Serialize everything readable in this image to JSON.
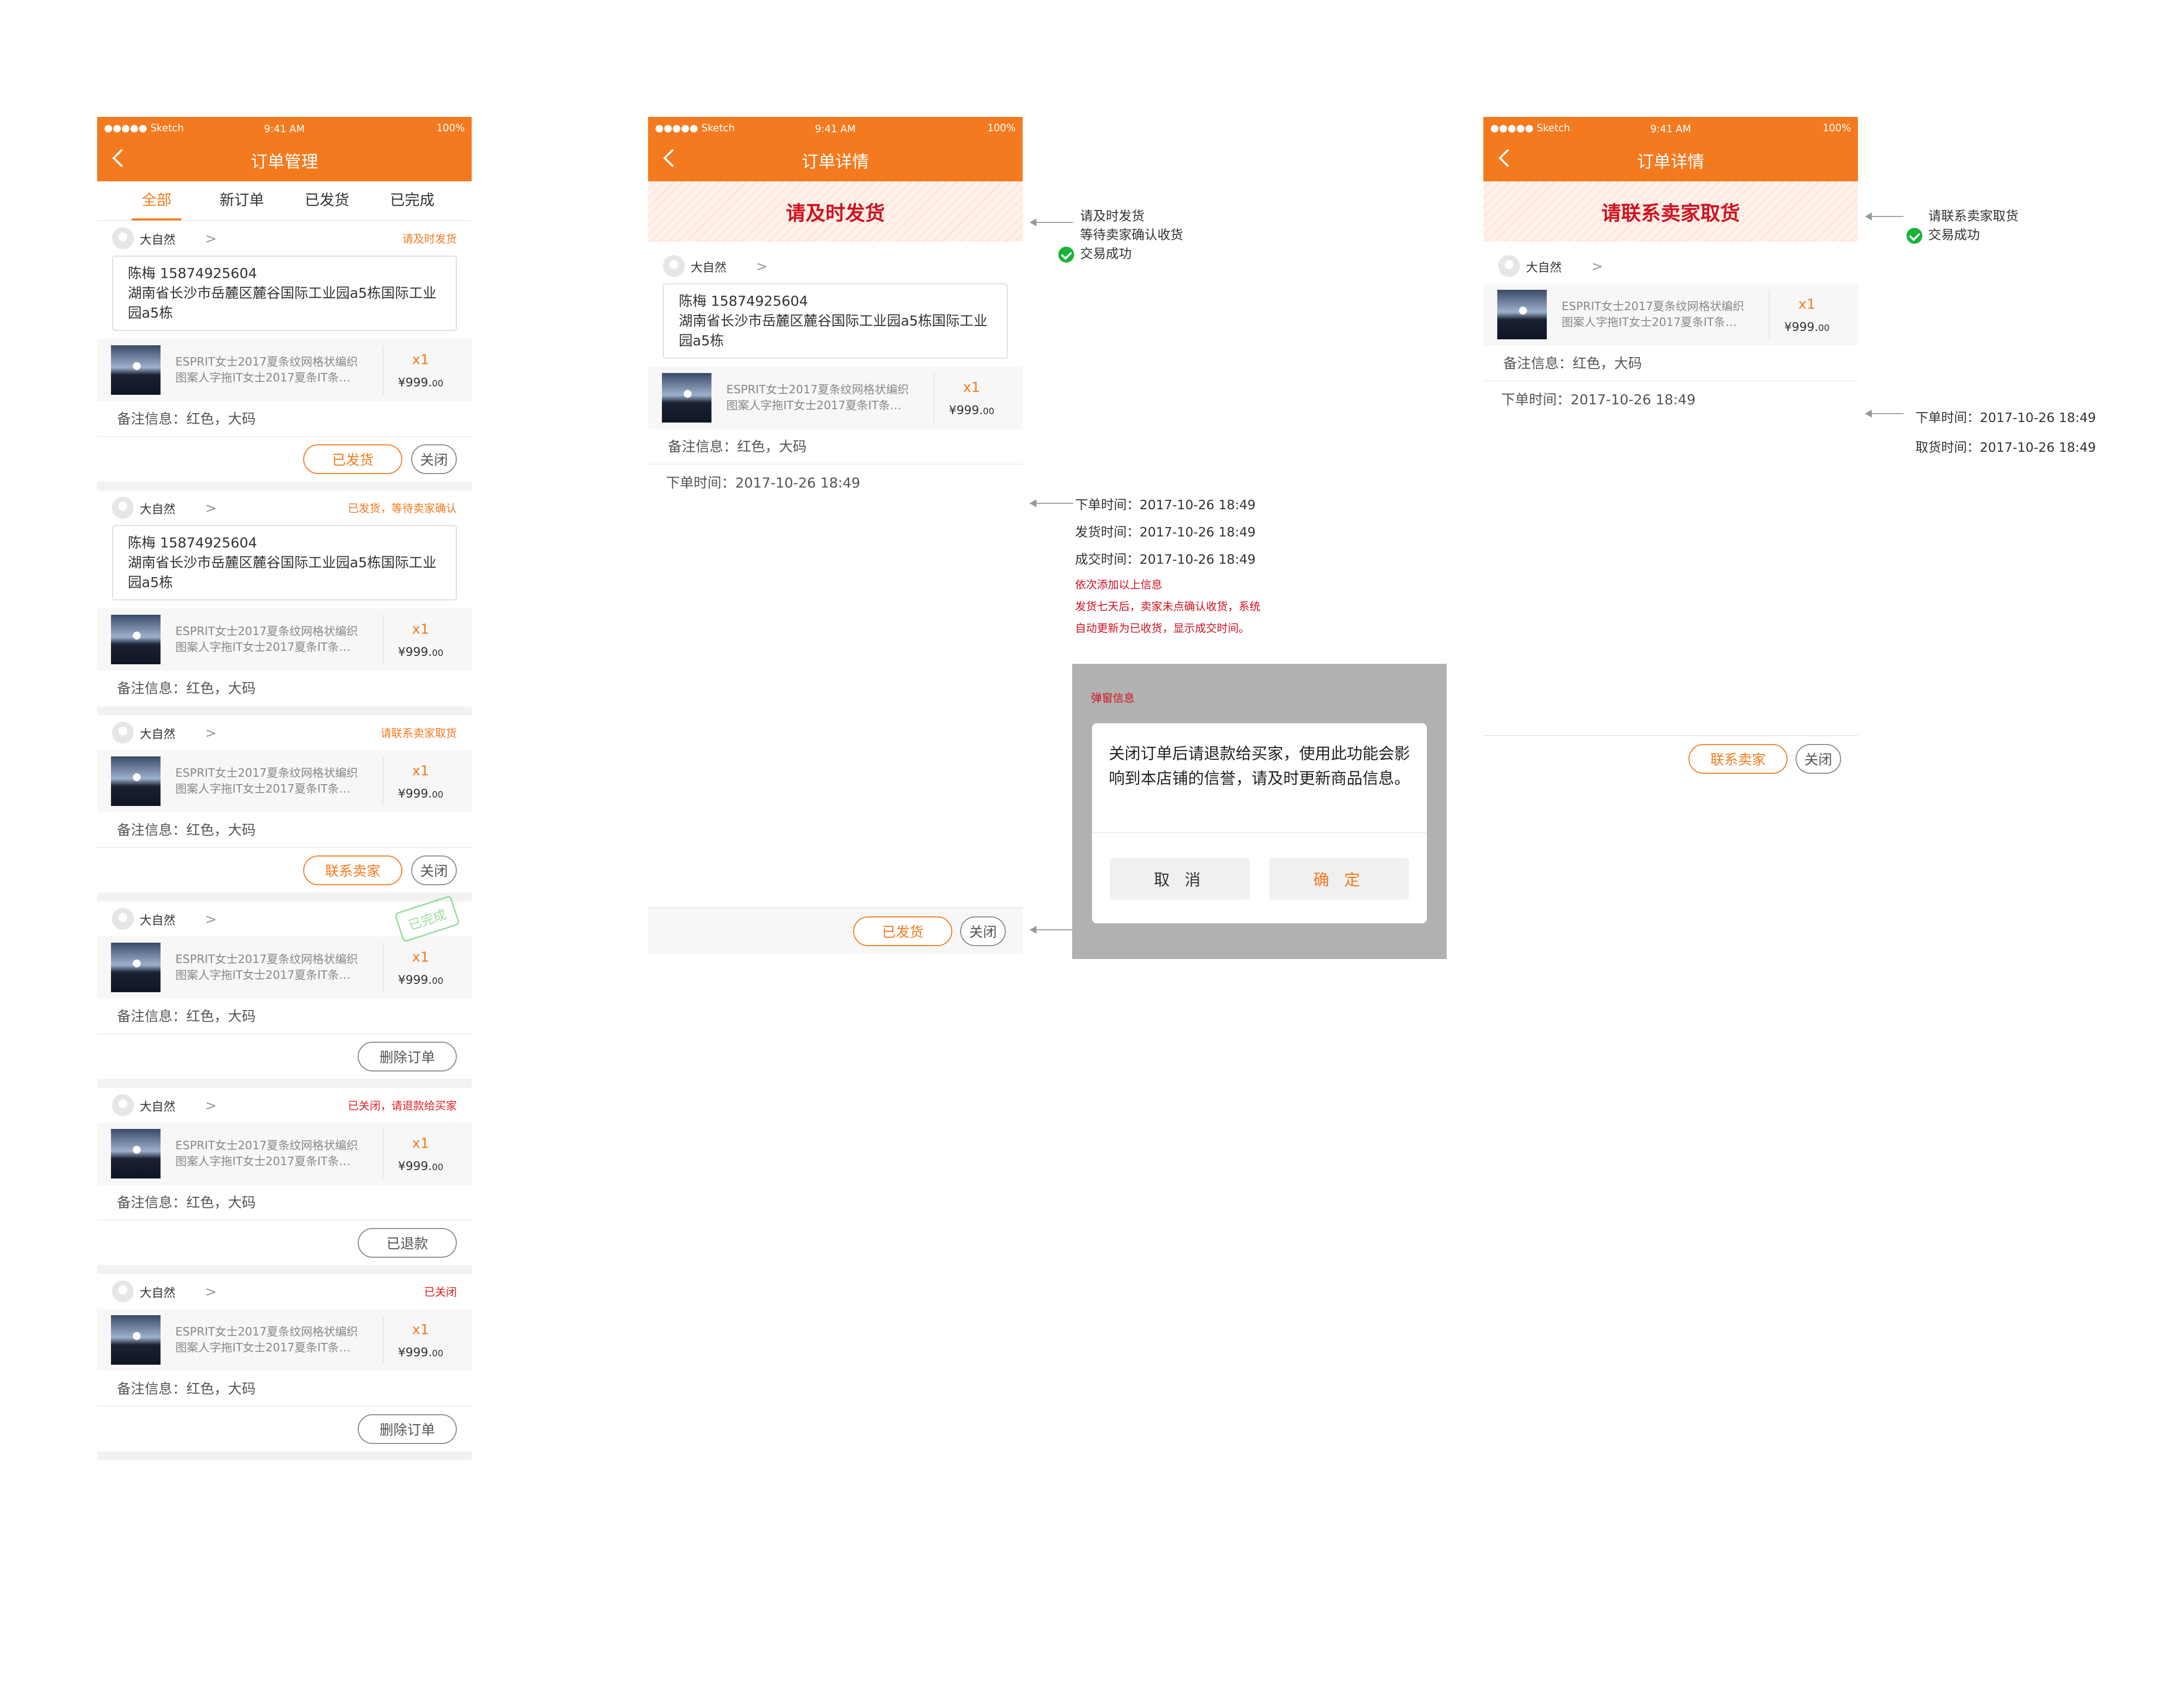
{
  "status_bar": {
    "carrier": "●●●●● Sketch",
    "time": "9:41 AM",
    "battery": "100%"
  },
  "common": {
    "shop": "大自然",
    "contact": "陈梅    15874925604",
    "address": "湖南省长沙市岳麓区麓谷国际工业园a5栋国际工业园a5栋",
    "product_line1": "ESPRIT女士2017夏条纹网格状编织",
    "product_line2": "图案人字拖IT女士2017夏条IT条…",
    "qty": "x1",
    "price": "¥999.",
    "price_cents": "00",
    "remark": "备注信息：红色，大码",
    "order_time": "下单时间：2017-10-26  18:49",
    "chevron": ">"
  },
  "screen1": {
    "title": "订单管理",
    "tabs": [
      "全部",
      "新订单",
      "已发货",
      "已完成"
    ],
    "orders": [
      {
        "status": "请及时发货",
        "btn1": "已发货",
        "btn2": "关闭"
      },
      {
        "status": "已发货，等待卖家确认"
      },
      {
        "status": "请联系卖家取货",
        "btn1": "联系卖家",
        "btn2": "关闭"
      },
      {
        "stamp": "已完成",
        "btn1": "删除订单"
      },
      {
        "status": "已关闭，请退款给买家",
        "btn1": "已退款"
      },
      {
        "status": "已关闭",
        "btn1": "删除订单"
      }
    ]
  },
  "screen2": {
    "title": "订单详情",
    "banner": "请及时发货",
    "btn1": "已发货",
    "btn2": "关闭",
    "note_status": [
      "请及时发货",
      "等待卖家确认收货",
      "交易成功"
    ],
    "note_times": [
      "下单时间：2017-10-26  18:49",
      "发货时间：2017-10-26  18:49",
      "成交时间：2017-10-26  18:49"
    ],
    "note_red": [
      "依次添加以上信息",
      "发货七天后，卖家未点确认收货，系统",
      "自动更新为已收货，显示成交时间。"
    ]
  },
  "modal": {
    "label": "弹窗信息",
    "text": "关闭订单后请退款给买家，使用此功能会影响到本店铺的信誉，请及时更新商品信息。",
    "cancel": "取 消",
    "confirm": "确 定"
  },
  "screen3": {
    "title": "订单详情",
    "banner": "请联系卖家取货",
    "btn1": "联系卖家",
    "btn2": "关闭",
    "note_status": [
      "请联系卖家取货",
      "交易成功"
    ],
    "note_times": [
      "下单时间：2017-10-26  18:49",
      "取货时间：2017-10-26  18:49"
    ]
  }
}
